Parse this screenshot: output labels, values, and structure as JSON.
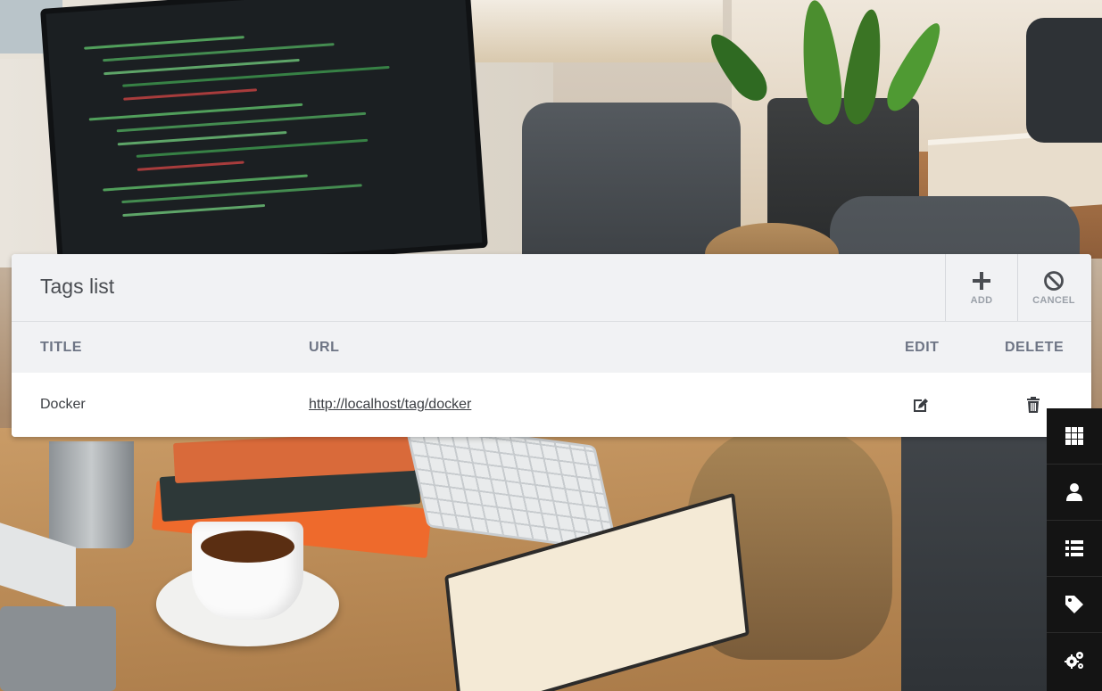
{
  "panel": {
    "title": "Tags list",
    "actions": {
      "add_label": "ADD",
      "cancel_label": "CANCEL"
    },
    "columns": {
      "title": "TITLE",
      "url": "URL",
      "edit": "EDIT",
      "delete": "DELETE"
    },
    "rows": [
      {
        "title": "Docker",
        "url": "http://localhost/tag/docker"
      }
    ]
  },
  "dock": {
    "items": [
      {
        "icon": "grid-icon"
      },
      {
        "icon": "user-icon"
      },
      {
        "icon": "list-icon"
      },
      {
        "icon": "tag-icon"
      },
      {
        "icon": "gears-icon"
      }
    ]
  },
  "colors": {
    "header_bg": "#f1f2f4",
    "column_header_text": "#6d7484",
    "icon_dark": "#4a4d52",
    "dock_bg": "#141414"
  }
}
